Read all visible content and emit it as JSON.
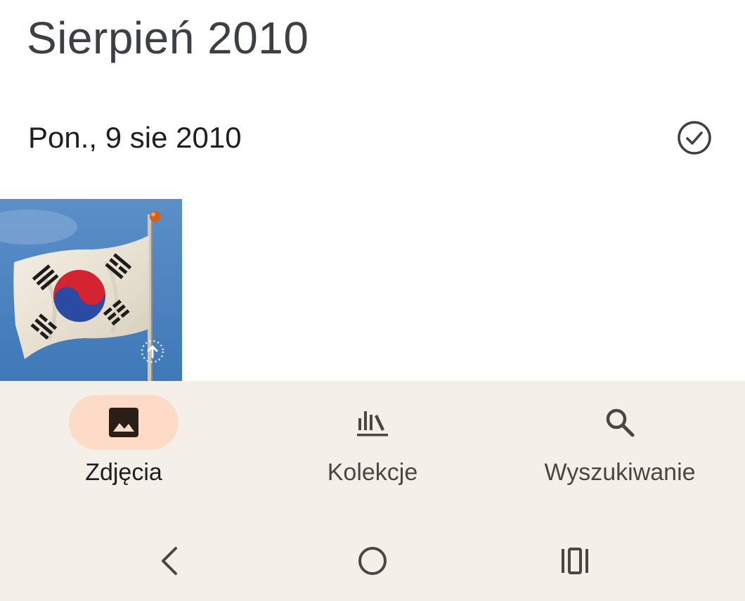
{
  "header": {
    "month_title": "Sierpień 2010"
  },
  "day_group": {
    "date_label": "Pon., 9 sie 2010",
    "select_icon": "check-circle-icon"
  },
  "photos": [
    {
      "subject": "south-korea-flag",
      "overlay_icon": "upload-pending-icon"
    }
  ],
  "bottom_nav": {
    "items": [
      {
        "label": "Zdjęcia",
        "icon": "photo-icon",
        "active": true
      },
      {
        "label": "Kolekcje",
        "icon": "library-icon",
        "active": false
      },
      {
        "label": "Wyszukiwanie",
        "icon": "search-icon",
        "active": false
      }
    ],
    "background": "#f4efe9",
    "active_pill_color": "#fddbc7"
  },
  "system_nav": {
    "back_icon": "back-chevron-icon",
    "home_icon": "home-circle-icon",
    "recents_icon": "recents-icon"
  }
}
